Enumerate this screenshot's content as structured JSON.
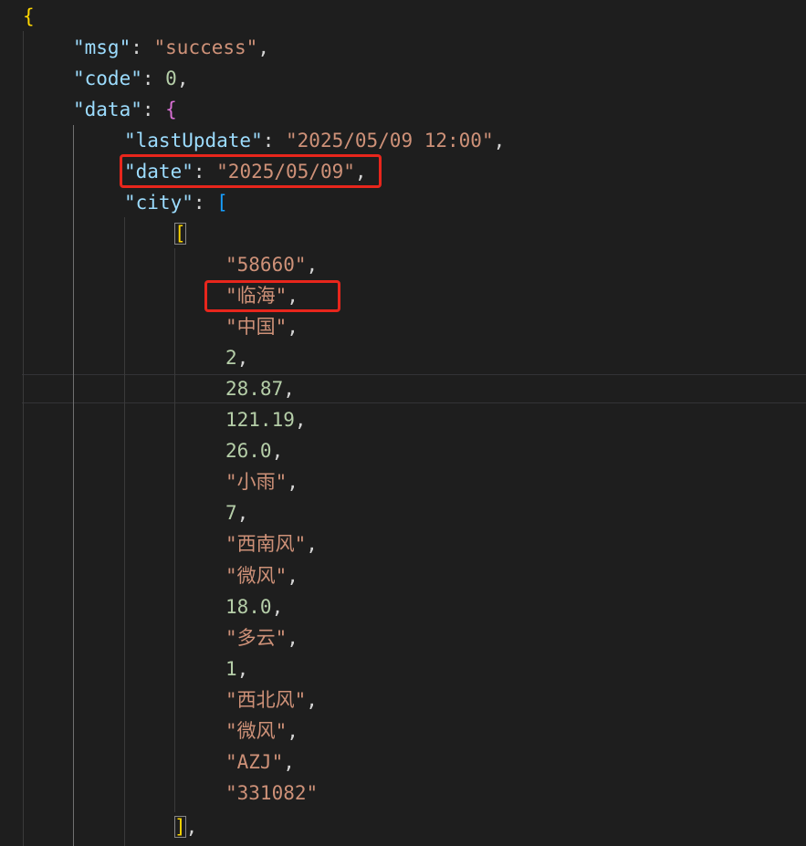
{
  "json": {
    "open_brace": "{",
    "msg": {
      "key": "\"msg\"",
      "value": "\"success\""
    },
    "code": {
      "key": "\"code\"",
      "value": "0"
    },
    "data": {
      "key": "\"data\"",
      "open_brace": "{",
      "lastUpdate": {
        "key": "\"lastUpdate\"",
        "value": "\"2025/05/09 12:00\""
      },
      "date": {
        "key": "\"date\"",
        "value": "\"2025/05/09\""
      },
      "city": {
        "key": "\"city\"",
        "open_bracket": "[",
        "inner_open": "[",
        "items": [
          "\"58660\"",
          "\"临海\"",
          "\"中国\"",
          "2",
          "28.87",
          "121.19",
          "26.0",
          "\"小雨\"",
          "7",
          "\"西南风\"",
          "\"微风\"",
          "18.0",
          "\"多云\"",
          "1",
          "\"西北风\"",
          "\"微风\"",
          "\"AZJ\"",
          "\"331082\""
        ],
        "inner_close": "]"
      }
    }
  },
  "colors": {
    "background": "#1e1e1e",
    "key": "#9cdcfe",
    "string": "#ce9178",
    "number": "#b5cea8",
    "bracket_level1": "#ffd700",
    "bracket_level2": "#da70d6",
    "bracket_level3": "#179fff",
    "annotation": "#e8261c"
  }
}
